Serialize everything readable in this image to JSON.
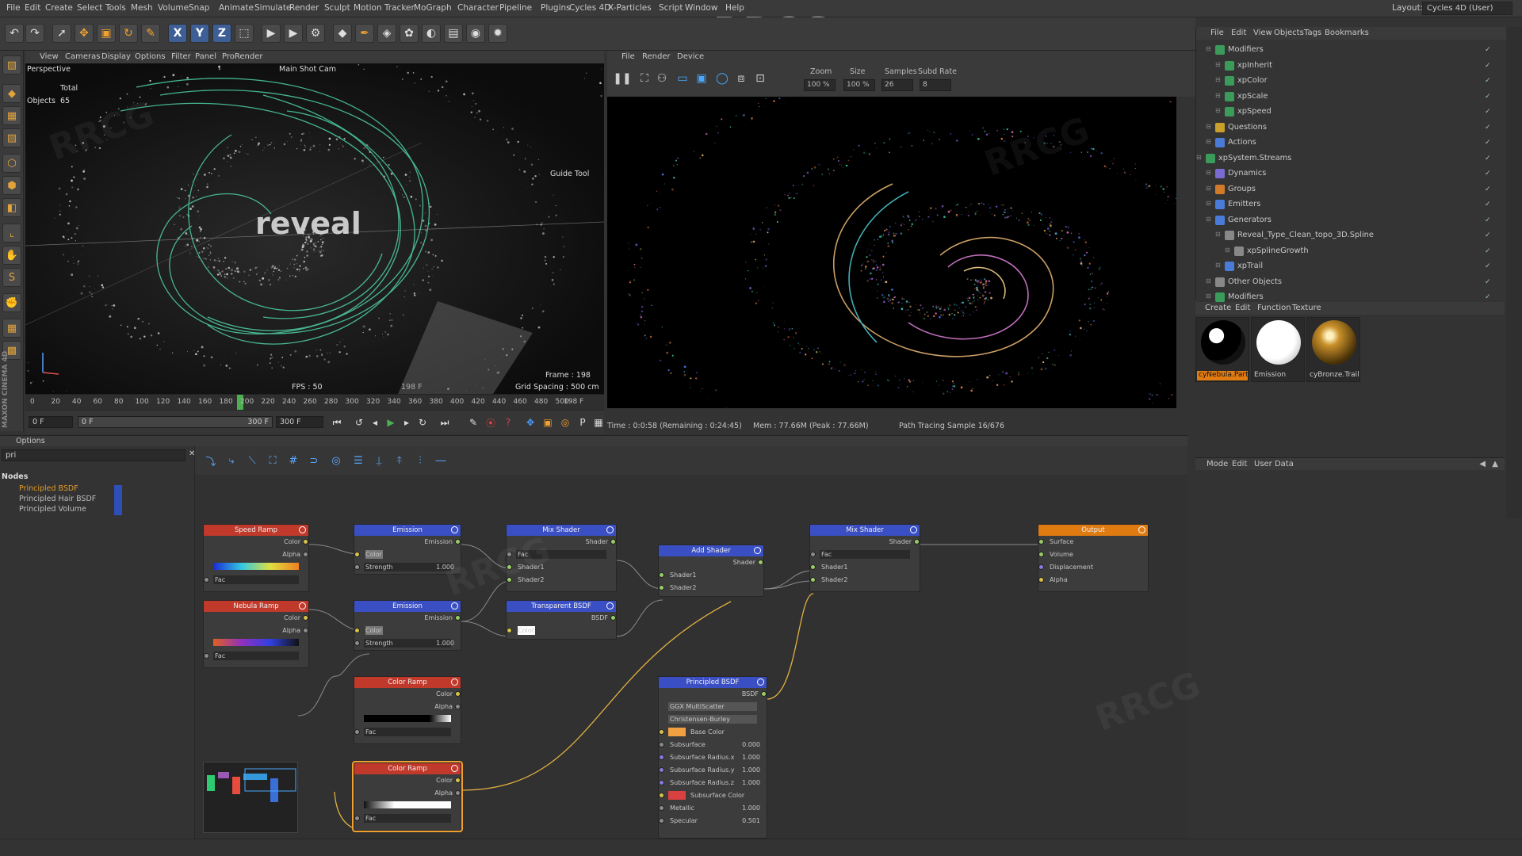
{
  "menu": [
    "File",
    "Edit",
    "Create",
    "Select",
    "Tools",
    "Mesh",
    "Volume",
    "Snap",
    "Animate",
    "Simulate",
    "Render",
    "Sculpt",
    "Motion Tracker",
    "MoGraph",
    "Character",
    "Pipeline",
    "Plugins",
    "Cycles 4D",
    "X-Particles",
    "Script",
    "Window",
    "Help"
  ],
  "layout": {
    "label": "Layout:",
    "value": "Cycles 4D (User)"
  },
  "watermark": "RRCG",
  "toolbar": {
    "x": "X",
    "y": "Y",
    "z": "Z"
  },
  "viewport": {
    "menu": [
      "View",
      "Cameras",
      "Display",
      "Options",
      "Filter",
      "Panel",
      "ProRender"
    ],
    "mode": "Perspective",
    "camera": "Main Shot Cam",
    "total_label": "Total",
    "objects_label": "Objects",
    "objects_value": "65",
    "guide_tool": "Guide Tool",
    "frame": "Frame : 198",
    "grid_spacing": "Grid Spacing : 500 cm",
    "fps": "FPS : 50",
    "frame_badge": "198 F",
    "overlay_text": "reveal",
    "axes": "Y Z"
  },
  "timeline": {
    "ticks": [
      "0",
      "20",
      "40",
      "60",
      "80",
      "100",
      "120",
      "140",
      "160",
      "180",
      "200",
      "220",
      "240",
      "260",
      "280",
      "300",
      "320",
      "340",
      "360",
      "380",
      "400",
      "420",
      "440",
      "460",
      "480",
      "500"
    ],
    "current": "198",
    "end_field": "198 F",
    "playhead_fraction": 0.396,
    "start": "0 F",
    "range_start": "0 F",
    "range_end": "300 F",
    "max": "300 F"
  },
  "render_view": {
    "menu": [
      "File",
      "Render",
      "Device"
    ],
    "zoom_label": "Zoom",
    "zoom": "100 %",
    "size_label": "Size",
    "size": "100 %",
    "samples_label": "Samples",
    "samples": "26",
    "subd_label": "Subd Rate",
    "subd": "8",
    "status_time": "Time : 0:0:58 (Remaining : 0:24:45)",
    "status_mem": "Mem : 77.66M (Peak : 77.66M)",
    "status_pt": "Path Tracing Sample 16/676"
  },
  "object_manager": {
    "menu": [
      "File",
      "Edit",
      "View",
      "Objects",
      "Tags",
      "Bookmarks"
    ],
    "rows": [
      {
        "label": "Modifiers",
        "depth": 1,
        "icon": "#3a9b5b"
      },
      {
        "label": "xpInherit",
        "depth": 2,
        "icon": "#3a9b5b"
      },
      {
        "label": "xpColor",
        "depth": 2,
        "icon": "#3a9b5b"
      },
      {
        "label": "xpScale",
        "depth": 2,
        "icon": "#3a9b5b"
      },
      {
        "label": "xpSpeed",
        "depth": 2,
        "icon": "#3a9b5b"
      },
      {
        "label": "Questions",
        "depth": 1,
        "icon": "#c8a02a"
      },
      {
        "label": "Actions",
        "depth": 1,
        "icon": "#4a7bd6"
      },
      {
        "label": "xpSystem.Streams",
        "depth": 0,
        "icon": "#3a9b5b"
      },
      {
        "label": "Dynamics",
        "depth": 1,
        "icon": "#7a6bd0"
      },
      {
        "label": "Groups",
        "depth": 1,
        "icon": "#d07a2a"
      },
      {
        "label": "Emitters",
        "depth": 1,
        "icon": "#4a7bd6"
      },
      {
        "label": "Generators",
        "depth": 1,
        "icon": "#4a7bd6"
      },
      {
        "label": "Reveal_Type_Clean_topo_3D.Spline",
        "depth": 2,
        "icon": "#888888"
      },
      {
        "label": "xpSplineGrowth",
        "depth": 3,
        "icon": "#888888"
      },
      {
        "label": "xpTrail",
        "depth": 2,
        "icon": "#4a7bd6"
      },
      {
        "label": "Other Objects",
        "depth": 1,
        "icon": "#888888"
      },
      {
        "label": "Modifiers",
        "depth": 1,
        "icon": "#3a9b5b"
      }
    ]
  },
  "material_manager": {
    "menu": [
      "Create",
      "Edit",
      "Function",
      "Texture"
    ],
    "materials": [
      {
        "name": "cyNebula.Partic",
        "selected": true
      },
      {
        "name": "Emission",
        "selected": false
      },
      {
        "name": "cyBronze.Trails",
        "selected": false
      }
    ]
  },
  "attributes": {
    "menu": [
      "Mode",
      "Edit",
      "User Data"
    ]
  },
  "node_editor": {
    "options_label": "Options",
    "search_value": "pri",
    "nodes_header": "Nodes",
    "list": [
      "Principled BSDF",
      "Principled Hair BSDF",
      "Principled Volume"
    ],
    "nodes": {
      "speed_ramp": {
        "title": "Speed Ramp",
        "out1": "Color",
        "out2": "Alpha",
        "in1": "Fac"
      },
      "nebula_ramp": {
        "title": "Nebula Ramp",
        "out1": "Color",
        "out2": "Alpha",
        "in1": "Fac"
      },
      "emission1": {
        "title": "Emission",
        "out1": "Emission",
        "in1": "Color",
        "in2": "Strength",
        "strength": "1.000"
      },
      "emission2": {
        "title": "Emission",
        "out1": "Emission",
        "in1": "Color",
        "in2": "Strength",
        "strength": "1.000"
      },
      "color_ramp1": {
        "title": "Color Ramp",
        "out1": "Color",
        "out2": "Alpha",
        "in1": "Fac"
      },
      "color_ramp2": {
        "title": "Color Ramp",
        "out1": "Color",
        "out2": "Alpha",
        "in1": "Fac"
      },
      "mix1": {
        "title": "Mix Shader",
        "out1": "Shader",
        "in1": "Fac",
        "in2": "Shader1",
        "in3": "Shader2"
      },
      "transparent": {
        "title": "Transparent BSDF",
        "out1": "BSDF",
        "in1": "Color"
      },
      "add": {
        "title": "Add Shader",
        "out1": "Shader",
        "in1": "Shader1",
        "in2": "Shader2"
      },
      "mix2": {
        "title": "Mix Shader",
        "out1": "Shader",
        "in1": "Fac",
        "in2": "Shader1",
        "in3": "Shader2"
      },
      "output": {
        "title": "Output",
        "in1": "Surface",
        "in2": "Volume",
        "in3": "Displacement",
        "in4": "Alpha"
      },
      "principled": {
        "title": "Principled BSDF",
        "out1": "BSDF",
        "dist": "GGX MultiScatter",
        "sss": "Christensen-Burley",
        "base_color": "Base Color",
        "subsurface": "Subsurface",
        "subsurface_v": "0.000",
        "ssr_x": "Subsurface Radius.x",
        "ssr_x_v": "1.000",
        "ssr_y": "Subsurface Radius.y",
        "ssr_y_v": "1.000",
        "ssr_z": "Subsurface Radius.z",
        "ssr_z_v": "1.000",
        "ss_color": "Subsurface Color",
        "metallic": "Metallic",
        "metallic_v": "1.000",
        "specular": "Specular",
        "specular_v": "0.501"
      }
    }
  },
  "colors": {
    "ramp_header": "#c0392b",
    "shader_header": "#3a4fc4",
    "output_header": "#e07b12",
    "selection": "#f0a030"
  }
}
